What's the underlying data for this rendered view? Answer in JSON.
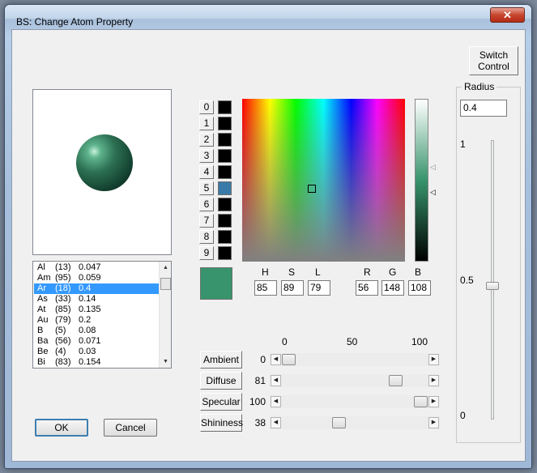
{
  "window": {
    "title": "BS: Change Atom Property",
    "close_glyph": "✕"
  },
  "element_list": {
    "items": [
      {
        "element": "Al",
        "number": "(13)",
        "value": "0.047",
        "selected": false
      },
      {
        "element": "Am",
        "number": "(95)",
        "value": "0.059",
        "selected": false
      },
      {
        "element": "Ar",
        "number": "(18)",
        "value": "0.4",
        "selected": true
      },
      {
        "element": "As",
        "number": "(33)",
        "value": "0.14",
        "selected": false
      },
      {
        "element": "At",
        "number": "(85)",
        "value": "0.135",
        "selected": false
      },
      {
        "element": "Au",
        "number": "(79)",
        "value": "0.2",
        "selected": false
      },
      {
        "element": "B",
        "number": "(5)",
        "value": "0.08",
        "selected": false
      },
      {
        "element": "Ba",
        "number": "(56)",
        "value": "0.071",
        "selected": false
      },
      {
        "element": "Be",
        "number": "(4)",
        "value": "0.03",
        "selected": false
      },
      {
        "element": "Bi",
        "number": "(83)",
        "value": "0.154",
        "selected": false
      }
    ]
  },
  "buttons": {
    "ok": "OK",
    "cancel": "Cancel",
    "switch_line1": "Switch",
    "switch_line2": "Control"
  },
  "color_slots": [
    {
      "label": "0",
      "color": "#000000"
    },
    {
      "label": "1",
      "color": "#000000"
    },
    {
      "label": "2",
      "color": "#000000"
    },
    {
      "label": "3",
      "color": "#000000"
    },
    {
      "label": "4",
      "color": "#000000"
    },
    {
      "label": "5",
      "color": "#3a7aa8"
    },
    {
      "label": "6",
      "color": "#000000"
    },
    {
      "label": "7",
      "color": "#000000"
    },
    {
      "label": "8",
      "color": "#000000"
    },
    {
      "label": "9",
      "color": "#000000"
    }
  ],
  "current_color": "#38946c",
  "color_values": {
    "h_label": "H",
    "s_label": "S",
    "l_label": "L",
    "r_label": "R",
    "g_label": "G",
    "b_label": "B",
    "h": "85",
    "s": "89",
    "l": "79",
    "r": "56",
    "g": "148",
    "b": "108"
  },
  "scale": {
    "min": "0",
    "mid": "50",
    "max": "100"
  },
  "properties": [
    {
      "label": "Ambient",
      "value": "0",
      "level": 0
    },
    {
      "label": "Diffuse",
      "value": "81",
      "level": 81
    },
    {
      "label": "Specular",
      "value": "100",
      "level": 100
    },
    {
      "label": "Shininess",
      "value": "38",
      "level": 38
    }
  ],
  "radius": {
    "group_label": "Radius",
    "value": "0.4",
    "tick_top": "1",
    "tick_mid": "0.5",
    "tick_bottom": "0",
    "level": 0.4
  },
  "icons": {
    "list_up": "up-arrow-icon",
    "list_down": "down-arrow-icon",
    "left": "left-arrow-icon",
    "right": "right-arrow-icon",
    "lum_marker_1": "triangle-left-icon",
    "lum_marker_2": "triangle-left-icon"
  }
}
